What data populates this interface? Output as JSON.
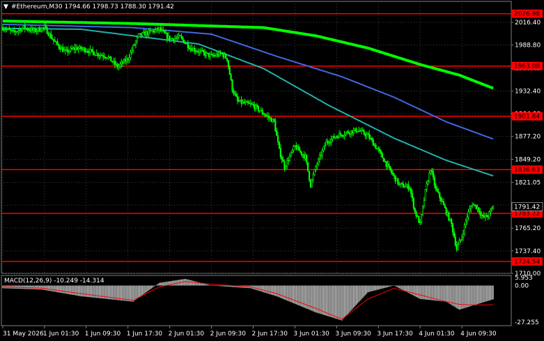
{
  "header": {
    "symbol_line": "#Ethereum,M30  1794.66 1798.73 1788.30 1791.42"
  },
  "macd_label": "MACD(12,26,9) -10.249 -14.314",
  "colors": {
    "background": "#000000",
    "candle": "#00ff00",
    "grid": "#404040",
    "level_line": "#ff0000",
    "level_tag_bg": "#ff0000",
    "current_price_tag_bg": "#000000",
    "ma_slow": "#00ff00",
    "ma_mid": "#4169e1",
    "ma_fast": "#20b2aa",
    "macd_hist": "#c0c0c0",
    "macd_signal": "#ff0000",
    "axis_text": "#ffffff"
  },
  "chart_data": {
    "type": "candlestick",
    "timeframe": "M30",
    "price_axis": {
      "range": [
        1710.0,
        2042.0
      ],
      "ticks": [
        "2016.40",
        "1988.80",
        "1960.45",
        "1932.40",
        "1904.80",
        "1877.20",
        "1849.20",
        "1821.05",
        "1793.45",
        "1765.20",
        "1737.40",
        "1710.00"
      ]
    },
    "horizontal_levels": [
      {
        "value": 2026.98,
        "label": "2026.98"
      },
      {
        "value": 1963.08,
        "label": "1963.08"
      },
      {
        "value": 1901.84,
        "label": "1901.84"
      },
      {
        "value": 1836.63,
        "label": "1836.63"
      },
      {
        "value": 1783.22,
        "label": "1783.22"
      },
      {
        "value": 1724.54,
        "label": "1724.54"
      }
    ],
    "current_price": {
      "value": 1791.42,
      "label": "1791.42"
    },
    "time_axis": [
      "31 May 2026",
      "1 Jun 01:30",
      "1 Jun 09:30",
      "1 Jun 17:30",
      "2 Jun 01:30",
      "2 Jun 09:30",
      "2 Jun 17:30",
      "3 Jun 01:30",
      "3 Jun 09:30",
      "3 Jun 17:30",
      "4 Jun 01:30",
      "4 Jun 09:30"
    ],
    "price_anchors": [
      [
        0,
        2010
      ],
      [
        8,
        2004
      ],
      [
        16,
        2010
      ],
      [
        24,
        2006
      ],
      [
        32,
        2010
      ],
      [
        40,
        1992
      ],
      [
        48,
        1980
      ],
      [
        56,
        1985
      ],
      [
        64,
        1983
      ],
      [
        72,
        1978
      ],
      [
        80,
        1975
      ],
      [
        88,
        1962
      ],
      [
        96,
        1972
      ],
      [
        104,
        2000
      ],
      [
        112,
        2004
      ],
      [
        120,
        2008
      ],
      [
        128,
        1996
      ],
      [
        136,
        1998
      ],
      [
        144,
        1985
      ],
      [
        152,
        1980
      ],
      [
        160,
        1975
      ],
      [
        168,
        1978
      ],
      [
        172,
        1972
      ],
      [
        176,
        1935
      ],
      [
        180,
        1920
      ],
      [
        184,
        1918
      ],
      [
        192,
        1915
      ],
      [
        200,
        1905
      ],
      [
        208,
        1895
      ],
      [
        212,
        1860
      ],
      [
        216,
        1840
      ],
      [
        224,
        1865
      ],
      [
        232,
        1852
      ],
      [
        236,
        1818
      ],
      [
        240,
        1840
      ],
      [
        248,
        1870
      ],
      [
        256,
        1878
      ],
      [
        264,
        1882
      ],
      [
        272,
        1885
      ],
      [
        280,
        1878
      ],
      [
        288,
        1860
      ],
      [
        296,
        1838
      ],
      [
        304,
        1818
      ],
      [
        312,
        1815
      ],
      [
        316,
        1785
      ],
      [
        320,
        1770
      ],
      [
        324,
        1810
      ],
      [
        328,
        1838
      ],
      [
        332,
        1812
      ],
      [
        336,
        1800
      ],
      [
        340,
        1785
      ],
      [
        344,
        1770
      ],
      [
        348,
        1740
      ],
      [
        352,
        1755
      ],
      [
        356,
        1780
      ],
      [
        360,
        1795
      ],
      [
        364,
        1790
      ],
      [
        368,
        1778
      ],
      [
        372,
        1780
      ],
      [
        376,
        1791.42
      ]
    ],
    "moving_averages": [
      {
        "id": "ma_slow",
        "points": [
          [
            0,
            2018
          ],
          [
            100,
            2015
          ],
          [
            200,
            2010
          ],
          [
            240,
            2000
          ],
          [
            280,
            1985
          ],
          [
            320,
            1965
          ],
          [
            350,
            1952
          ],
          [
            376,
            1936
          ]
        ]
      },
      {
        "id": "ma_mid",
        "points": [
          [
            0,
            2014
          ],
          [
            100,
            2010
          ],
          [
            160,
            2002
          ],
          [
            210,
            1975
          ],
          [
            260,
            1950
          ],
          [
            300,
            1925
          ],
          [
            340,
            1895
          ],
          [
            376,
            1874
          ]
        ]
      },
      {
        "id": "ma_fast",
        "points": [
          [
            0,
            2009
          ],
          [
            60,
            2008
          ],
          [
            100,
            2000
          ],
          [
            150,
            1990
          ],
          [
            200,
            1960
          ],
          [
            250,
            1915
          ],
          [
            300,
            1875
          ],
          [
            340,
            1848
          ],
          [
            376,
            1829
          ]
        ]
      }
    ],
    "macd": {
      "axis_range": [
        -27.255,
        5.953
      ],
      "ticks": [
        "5.953",
        "0.00",
        "-27.255"
      ],
      "histogram_anchors": [
        [
          0,
          -2
        ],
        [
          30,
          -3
        ],
        [
          60,
          -8
        ],
        [
          100,
          -12
        ],
        [
          120,
          2
        ],
        [
          140,
          5
        ],
        [
          160,
          0
        ],
        [
          190,
          -2
        ],
        [
          210,
          -8
        ],
        [
          240,
          -20
        ],
        [
          260,
          -26
        ],
        [
          280,
          -5
        ],
        [
          300,
          0
        ],
        [
          320,
          -10
        ],
        [
          340,
          -12
        ],
        [
          350,
          -18
        ],
        [
          360,
          -15
        ],
        [
          376,
          -10.249
        ]
      ],
      "signal_anchors": [
        [
          0,
          -1
        ],
        [
          30,
          -2
        ],
        [
          60,
          -6
        ],
        [
          100,
          -11
        ],
        [
          120,
          -1
        ],
        [
          140,
          3
        ],
        [
          160,
          1
        ],
        [
          190,
          -1
        ],
        [
          210,
          -6
        ],
        [
          240,
          -17
        ],
        [
          260,
          -25
        ],
        [
          280,
          -10
        ],
        [
          300,
          -2
        ],
        [
          320,
          -7
        ],
        [
          340,
          -12
        ],
        [
          350,
          -14
        ],
        [
          360,
          -14.5
        ],
        [
          376,
          -14.314
        ]
      ]
    }
  }
}
